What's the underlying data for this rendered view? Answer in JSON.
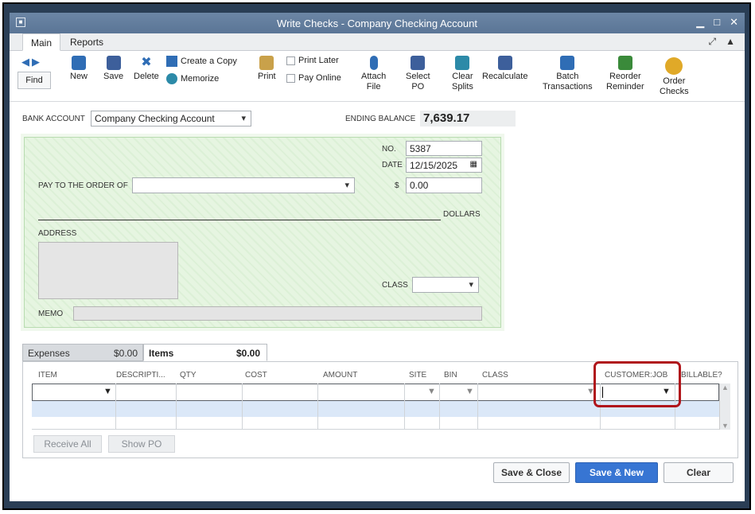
{
  "window": {
    "title": "Write Checks - Company Checking Account",
    "min": "▁",
    "max": "□",
    "close": "✕"
  },
  "menu": {
    "tabs": [
      "Main",
      "Reports"
    ],
    "right_icons": [
      "⤢",
      "▲"
    ]
  },
  "toolbar": {
    "find": "Find",
    "new": "New",
    "save": "Save",
    "delete": "Delete",
    "create_copy": "Create a Copy",
    "memorize": "Memorize",
    "print": "Print",
    "print_later": "Print Later",
    "pay_online": "Pay Online",
    "attach_file": [
      "Attach",
      "File"
    ],
    "select_po": [
      "Select",
      "PO"
    ],
    "clear_splits": [
      "Clear",
      "Splits"
    ],
    "recalculate": "Recalculate",
    "batch": [
      "Batch",
      "Transactions"
    ],
    "reorder": [
      "Reorder",
      "Reminder"
    ],
    "order_checks": [
      "Order",
      "Checks"
    ]
  },
  "account": {
    "label": "BANK ACCOUNT",
    "value": "Company Checking Account",
    "ending_label": "ENDING BALANCE",
    "ending_value": "7,639.17"
  },
  "check": {
    "no_label": "NO.",
    "no_value": "5387",
    "date_label": "DATE",
    "date_value": "12/15/2025",
    "pay_label": "PAY TO THE ORDER OF",
    "amount_label": "$",
    "amount_value": "0.00",
    "dollars_label": "DOLLARS",
    "address_label": "ADDRESS",
    "class_label": "CLASS",
    "memo_label": "MEMO"
  },
  "tabs": {
    "expenses": {
      "label": "Expenses",
      "amount": "$0.00"
    },
    "items": {
      "label": "Items",
      "amount": "$0.00"
    }
  },
  "grid": {
    "columns": [
      "ITEM",
      "DESCRIPTI...",
      "QTY",
      "COST",
      "AMOUNT",
      "SITE",
      "BIN",
      "CLASS",
      "CUSTOMER:JOB",
      "BILLABLE?"
    ]
  },
  "actions": {
    "receive_all": "Receive All",
    "show_po": "Show PO",
    "save_close": "Save & Close",
    "save_new": "Save & New",
    "clear": "Clear"
  },
  "colors": {
    "title_bar": "#5f7a9b",
    "primary_button": "#3775d3",
    "highlight": "#b0151b",
    "check_bg": "#e6f5e1"
  }
}
